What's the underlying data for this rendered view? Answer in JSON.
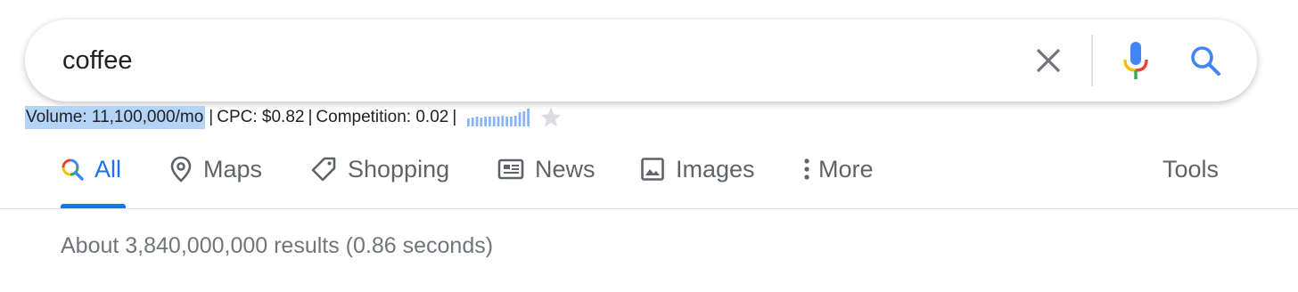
{
  "search": {
    "query": "coffee"
  },
  "icons": {
    "clear": "close-icon",
    "mic": "microphone-icon",
    "search": "search-icon"
  },
  "keyword_bar": {
    "volume": "Volume: 11,100,000/mo",
    "cpc": "CPC: $0.82",
    "competition": "Competition: 0.02",
    "separator": "|",
    "trend": [
      0.45,
      0.5,
      0.55,
      0.5,
      0.55,
      0.55,
      0.55,
      0.55,
      0.6,
      0.55,
      0.55,
      0.6,
      0.8,
      0.85,
      1.0
    ],
    "trend_color": "#8ab4f8",
    "star_color": "#dadce0"
  },
  "tabs": [
    {
      "label": "All",
      "icon": "google-search-icon",
      "active": true
    },
    {
      "label": "Maps",
      "icon": "map-pin-icon",
      "active": false
    },
    {
      "label": "Shopping",
      "icon": "tag-icon",
      "active": false
    },
    {
      "label": "News",
      "icon": "newspaper-icon",
      "active": false
    },
    {
      "label": "Images",
      "icon": "image-icon",
      "active": false
    },
    {
      "label": "More",
      "icon": "more-vert-icon",
      "active": false
    }
  ],
  "tools_label": "Tools",
  "result_stats": "About 3,840,000,000 results (0.86 seconds)",
  "colors": {
    "accent": "#1a73e8",
    "text": "#202124",
    "muted": "#5f6368",
    "volume_highlight": "#b3d3f7"
  }
}
